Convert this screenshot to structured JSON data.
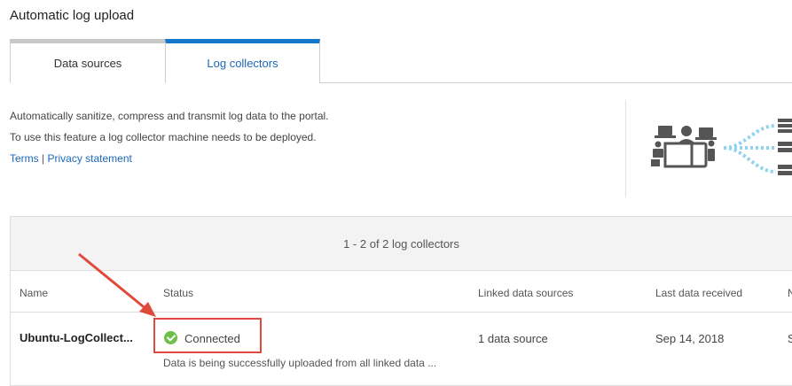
{
  "page": {
    "title": "Automatic log upload"
  },
  "tabs": [
    {
      "label": "Data sources",
      "active": false
    },
    {
      "label": "Log collectors",
      "active": true
    }
  ],
  "intro": {
    "line1": "Automatically sanitize, compress and transmit log data to the portal.",
    "line2": "To use this feature a log collector machine needs to be deployed.",
    "terms_link": "Terms",
    "separator": "|",
    "privacy_link": "Privacy statement"
  },
  "table": {
    "count_text": "1 - 2 of 2 log collectors",
    "columns": [
      "Name",
      "Status",
      "Linked data sources",
      "Last data received",
      "N"
    ],
    "rows": [
      {
        "name": "Ubuntu-LogCollect...",
        "status": "Connected",
        "status_detail": "Data is being successfully uploaded from all linked data ...",
        "linked_sources": "1 data source",
        "last_received": "Sep 14, 2018",
        "extra": "S"
      }
    ]
  },
  "colors": {
    "accent": "#1477c9",
    "link": "#1a68b8",
    "status_ok": "#6cc04a",
    "highlight": "#e04a3c",
    "illustration_flow": "#8fd3f0"
  },
  "icons": [
    "devices-illustration",
    "check-circle-icon",
    "annotation-arrow"
  ]
}
